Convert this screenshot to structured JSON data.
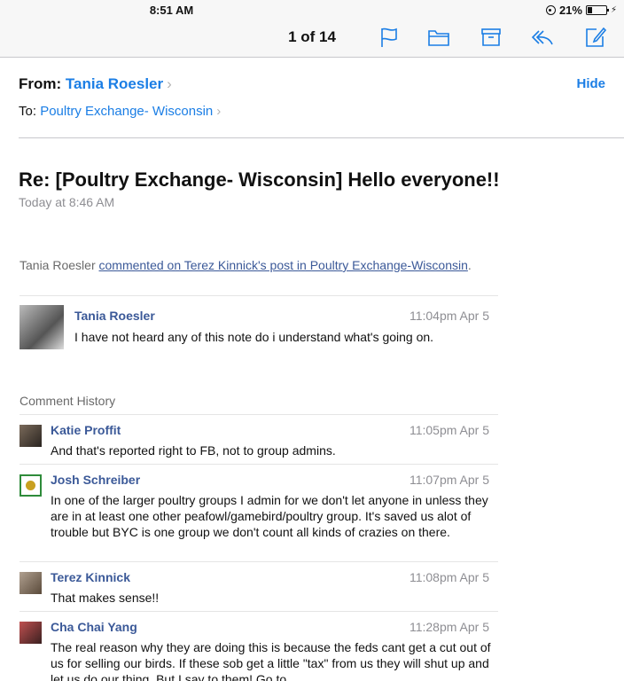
{
  "status": {
    "time": "8:51 AM",
    "battery": "21%"
  },
  "toolbar": {
    "counter": "1 of 14"
  },
  "header": {
    "from_label": "From:",
    "from_name": "Tania Roesler",
    "to_label": "To:",
    "to_name": "Poultry Exchange- Wisconsin",
    "hide_label": "Hide",
    "subject": "Re: [Poultry Exchange- Wisconsin] Hello everyone!!",
    "date": "Today at 8:46 AM"
  },
  "notice": {
    "author": "Tania Roesler",
    "link": "commented on Terez Kinnick's post in Poultry Exchange-Wisconsin",
    "end": "."
  },
  "main_comment": {
    "name": "Tania Roesler",
    "time": "11:04pm Apr 5",
    "text": "I have not heard any of this note do i understand what's going on."
  },
  "history_label": "Comment History",
  "history": [
    {
      "name": "Katie Proffit",
      "time": "11:05pm Apr 5",
      "text": "And that's reported right to FB, not to group admins."
    },
    {
      "name": "Josh Schreiber",
      "time": "11:07pm Apr 5",
      "text": "In one of the larger poultry groups I admin for we don't let anyone in unless they are in at least one other peafowl/gamebird/poultry group. It's saved us alot of trouble but BYC is one group we don't count all kinds of crazies on there."
    },
    {
      "name": "Terez Kinnick",
      "time": "11:08pm Apr 5",
      "text": "That makes sense!!"
    },
    {
      "name": "Cha Chai Yang",
      "time": "11:28pm Apr 5",
      "text": "The real reason why they are doing this is because the feds cant get a cut out of us for selling our birds. If these sob get a little \"tax\" from us they will shut up and let us do our thing. But I say to them! Go to"
    }
  ]
}
